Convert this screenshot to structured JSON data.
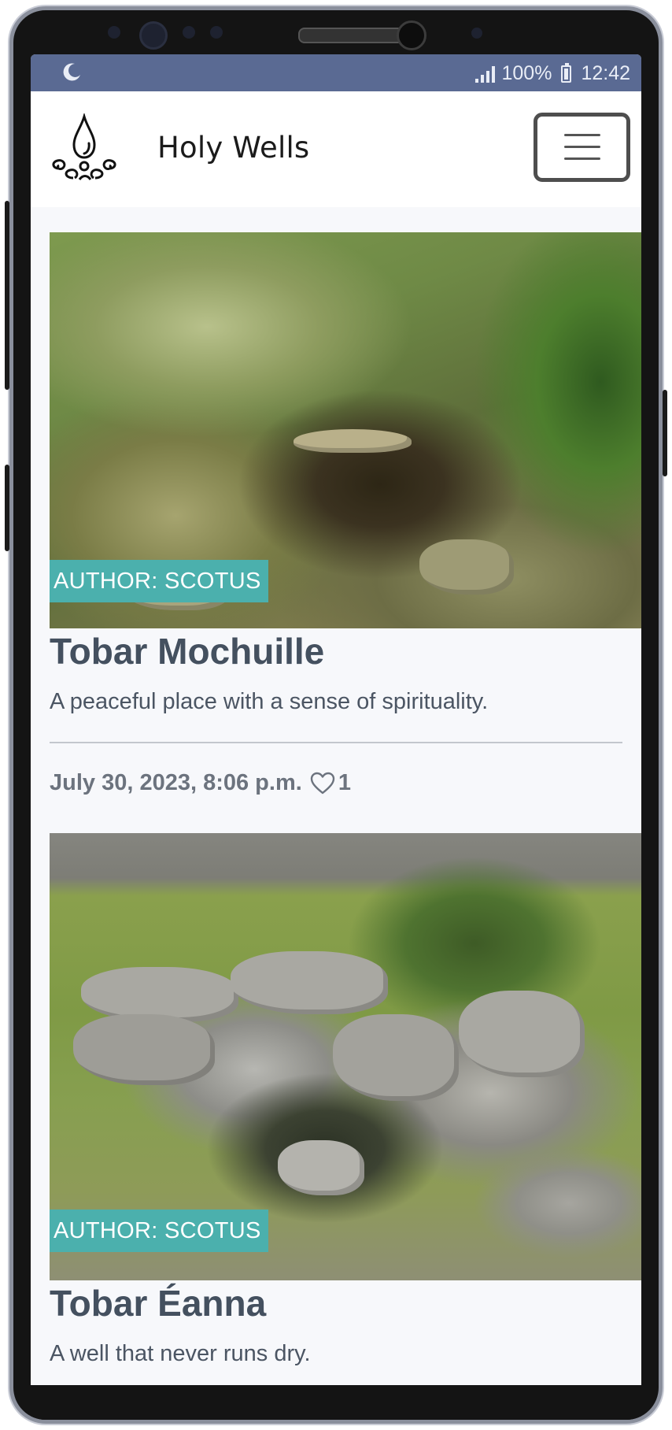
{
  "status_bar": {
    "battery_percent": "100%",
    "time": "12:42"
  },
  "navbar": {
    "brand": "Holy Wells"
  },
  "posts": [
    {
      "badge": "AUTHOR: SCOTUS",
      "title": "Tobar Mochuille",
      "excerpt": "A peaceful place with a sense of spirituality.",
      "date": "July 30, 2023, 8:06 p.m.",
      "likes": "1"
    },
    {
      "badge": "AUTHOR: SCOTUS",
      "title": "Tobar Éanna",
      "excerpt": "A well that never runs dry."
    }
  ],
  "colors": {
    "status_bar": "#5a6a93",
    "badge": "#4bb0ad",
    "title": "#44505f"
  }
}
